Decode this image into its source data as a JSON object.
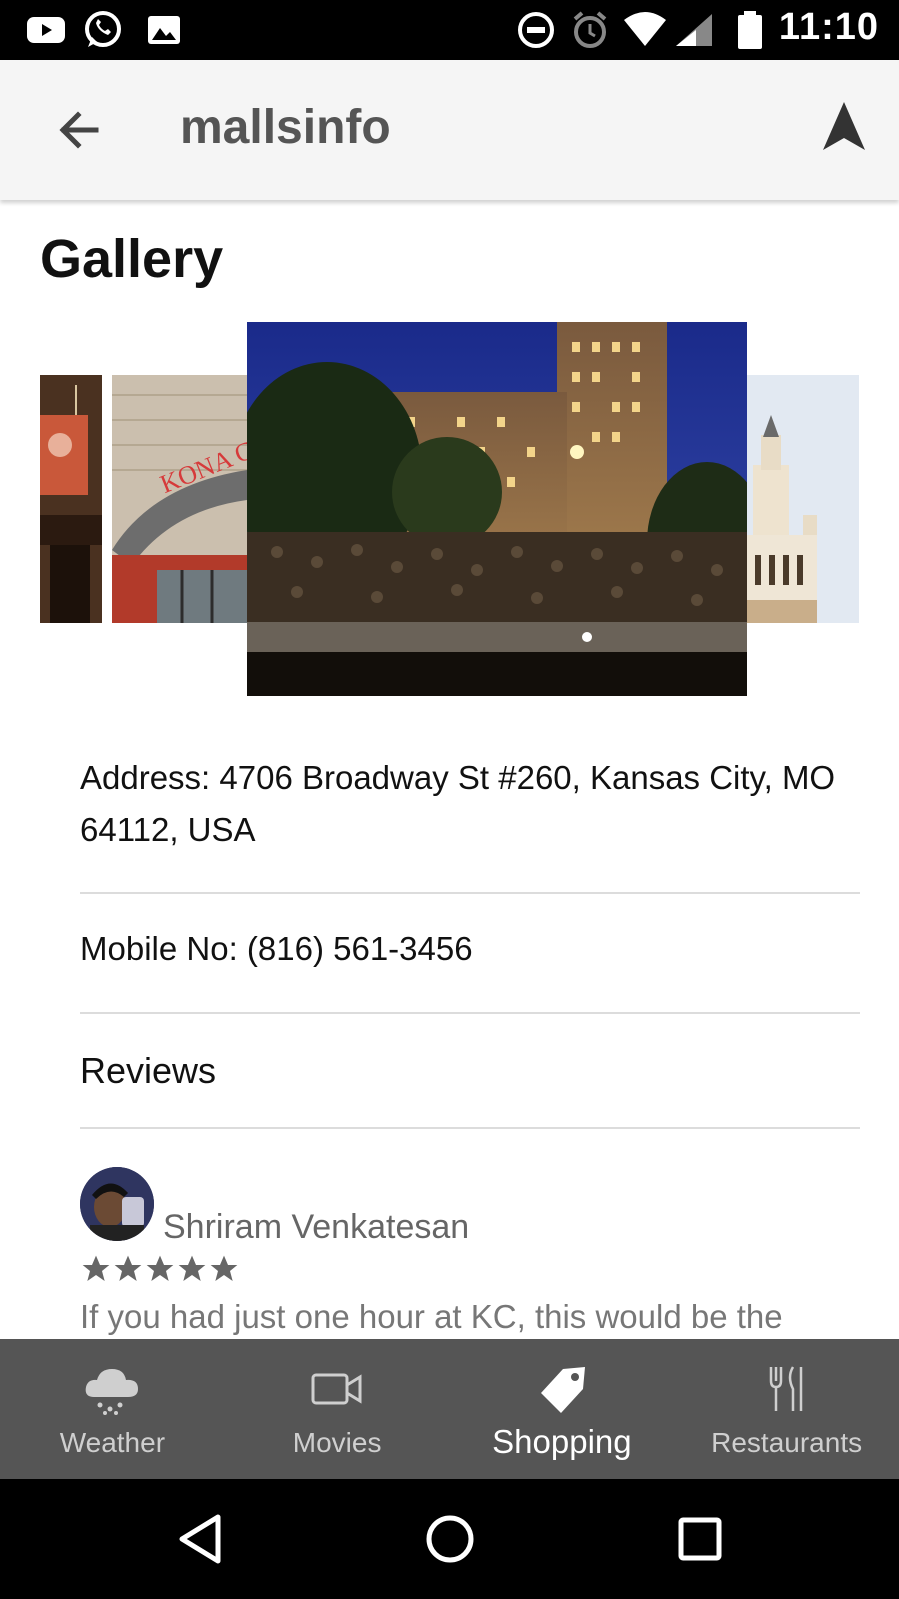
{
  "status_bar": {
    "time": "11:10"
  },
  "app_bar": {
    "title": "mallsinfo"
  },
  "gallery": {
    "title": "Gallery"
  },
  "details": {
    "address": "Address: 4706 Broadway St #260, Kansas City, MO 64112, USA",
    "mobile": "Mobile No: (816) 561-3456",
    "reviews_heading": "Reviews"
  },
  "review": {
    "author": "Shriram Venkatesan",
    "rating": 5,
    "text": "If you had just one hour at KC, this would be the"
  },
  "bottom_tabs": [
    {
      "label": "Weather",
      "icon": "weather-icon",
      "active": false
    },
    {
      "label": "Movies",
      "icon": "video-camera-icon",
      "active": false
    },
    {
      "label": "Shopping",
      "icon": "tag-icon",
      "active": true
    },
    {
      "label": "Restaurants",
      "icon": "fork-knife-icon",
      "active": false
    }
  ],
  "colors": {
    "tab_bar": "#555555",
    "app_bar": "#f5f5f5",
    "status_bar": "#000000"
  }
}
